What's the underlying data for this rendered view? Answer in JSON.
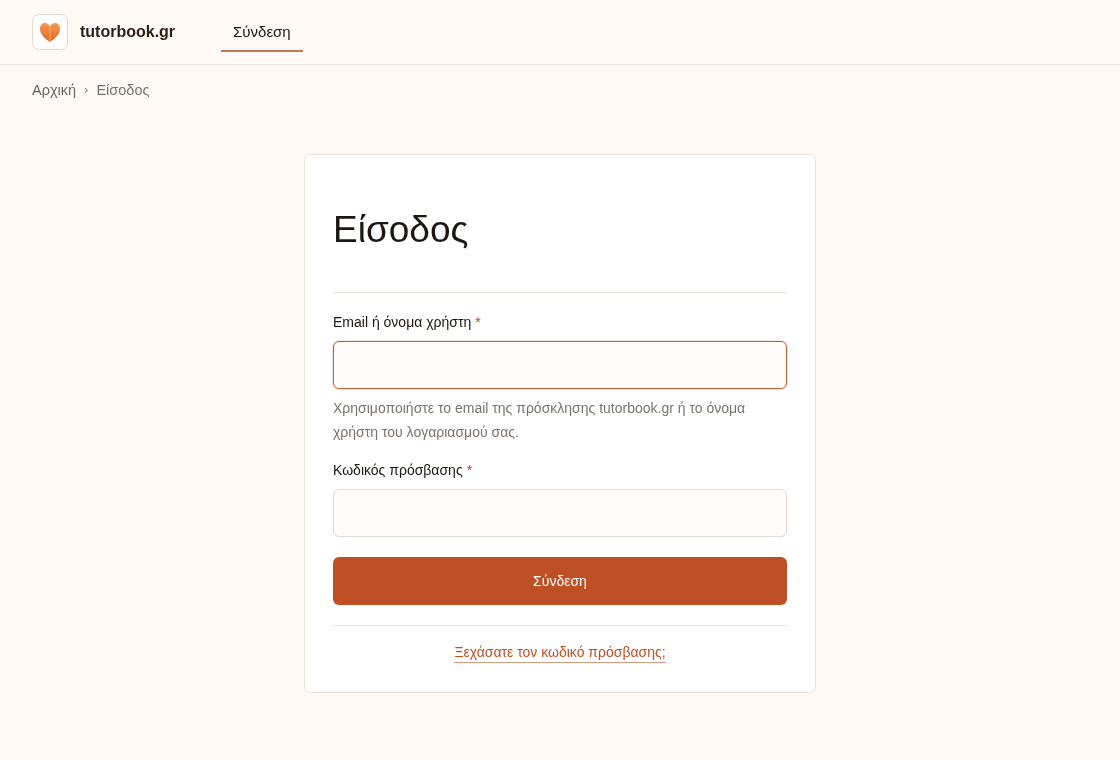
{
  "header": {
    "brand": "tutorbook.gr",
    "nav": [
      {
        "label": "Σύνδεση",
        "selected": true
      }
    ]
  },
  "breadcrumb": {
    "items": [
      "Αρχική",
      "Είσοδος"
    ],
    "separator": "›"
  },
  "card": {
    "title": "Είσοδος",
    "fields": [
      {
        "label": "Email ή όνομα χρήστη",
        "required_mark": "*",
        "focused": true,
        "help": "Χρησιμοποιήστε το email της πρόσκλησης tutorbook.gr ή το όνομα χρήστη του λογαριασμού σας."
      },
      {
        "label": "Κωδικός πρόσβασης",
        "required_mark": "*",
        "focused": false
      }
    ],
    "submit": "Σύνδεση",
    "forgot_link": "Ξεχάσατε τον κωδικό πρόσβασης;"
  }
}
